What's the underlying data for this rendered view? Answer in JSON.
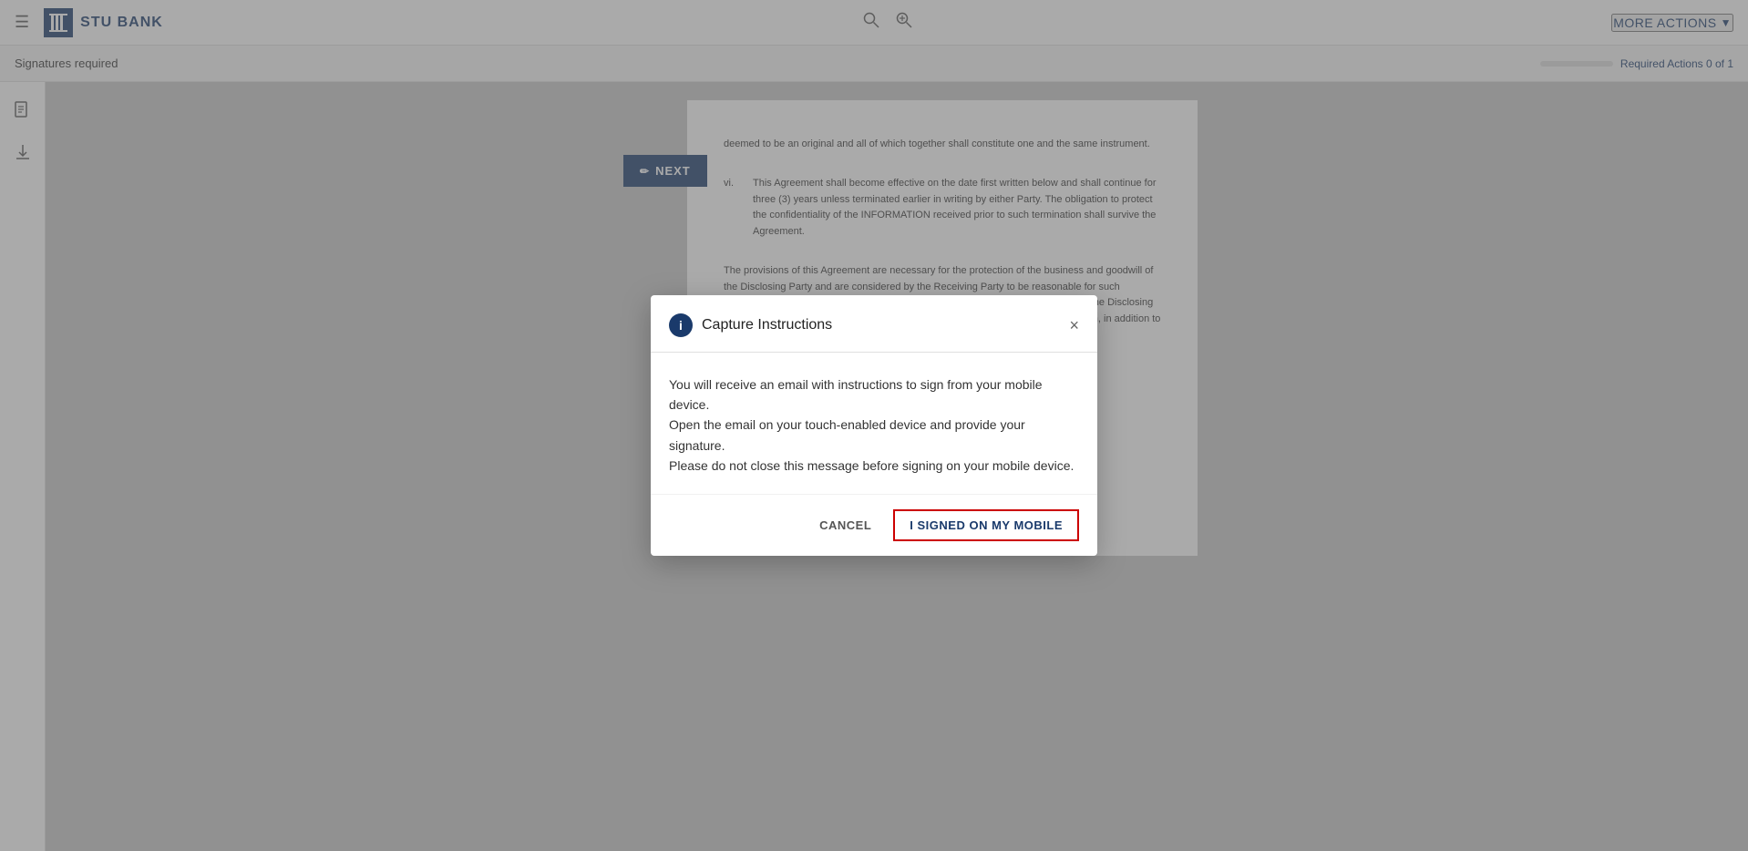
{
  "header": {
    "menu_icon": "☰",
    "logo_text": "STU BANK",
    "logo_icon_text": "|||",
    "search_icon_1": "🔍",
    "search_icon_2": "🔎",
    "more_actions_label": "MORE ACTIONS",
    "chevron": "▼"
  },
  "sub_header": {
    "signatures_required": "Signatures required",
    "required_actions_text": "Required Actions 0 of 1",
    "progress_percent": 0
  },
  "sidebar": {
    "doc_icon": "📄",
    "download_icon": "⬇"
  },
  "document": {
    "section_vi_label": "vi.",
    "section_vi_text": "This Agreement shall become effective on the date first written below and shall continue for three (3) years unless terminated earlier in writing by either Party. The obligation to protect the confidentiality of the INFORMATION received prior to such termination shall survive the Agreement.",
    "paragraph_text": "The provisions of this Agreement are necessary for the protection of the business and goodwill of the Disclosing Party and are considered by the Receiving Party to be reasonable for such purpose. The Receiving Party agrees that any breach of this Agreement will cause the Disclosing Party substantial and irreparable damage and, therefore, in the event of such breach, in addition to other remedies that may be",
    "prev_text": "deemed to be an original and all of which together shall constitute one and the same instrument.",
    "next_button_label": "NEXT",
    "next_button_icon": "✏"
  },
  "modal": {
    "title": "Capture Instructions",
    "info_icon": "i",
    "body_line1": "You will receive an email with instructions to sign from your mobile device.",
    "body_line2": "Open the email on your touch-enabled device and provide your signature.",
    "body_line3": "Please do not close this message before signing on your mobile device.",
    "cancel_label": "CANCEL",
    "signed_mobile_label": "I SIGNED ON MY MOBILE",
    "close_icon": "×"
  }
}
